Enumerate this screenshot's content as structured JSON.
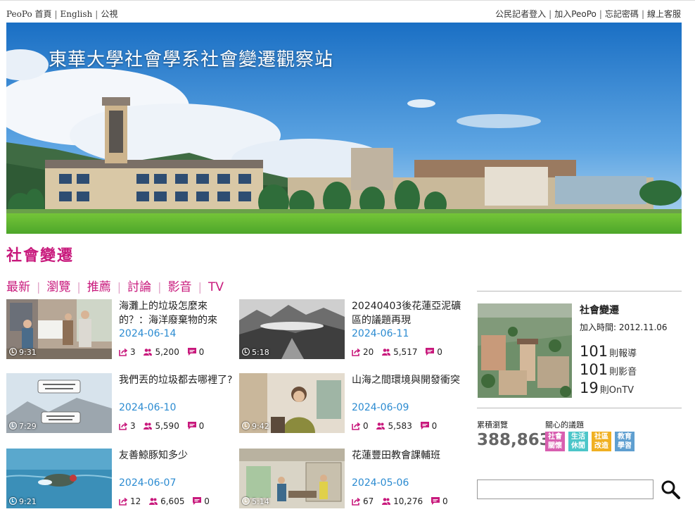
{
  "topbar": {
    "left": [
      "PeoPo 首頁",
      "English",
      "公視"
    ],
    "right": [
      "公民記者登入",
      "加入PeoPo",
      "忘記密碼",
      "線上客服"
    ]
  },
  "banner": {
    "title": "東華大學社會學系社會變遷觀察站"
  },
  "section": {
    "title": "社會變遷"
  },
  "tabs": [
    "最新",
    "瀏覽",
    "推薦",
    "討論",
    "影音",
    "TV"
  ],
  "articles": [
    {
      "title": "海灘上的垃圾怎麼來的？：海洋廢棄物的來",
      "date": "2024-06-14",
      "duration": "9:31",
      "shares": "3",
      "views": "5,200",
      "comments": "0"
    },
    {
      "title": "20240403後花蓮亞泥礦區的議題再現",
      "date": "2024-06-11",
      "duration": "5:18",
      "shares": "20",
      "views": "5,517",
      "comments": "0"
    },
    {
      "title": "我們丟的垃圾都去哪裡了?",
      "date": "2024-06-10",
      "duration": "7:29",
      "shares": "3",
      "views": "5,590",
      "comments": "0"
    },
    {
      "title": "山海之間環境與開發衝突",
      "date": "2024-06-09",
      "duration": "9:42",
      "shares": "0",
      "views": "5,583",
      "comments": "0"
    },
    {
      "title": "友善鯨豚知多少",
      "date": "2024-06-07",
      "duration": "9:21",
      "shares": "12",
      "views": "6,605",
      "comments": "0"
    },
    {
      "title": "花蓮豐田教會課輔班",
      "date": "2024-05-06",
      "duration": "5:14",
      "shares": "67",
      "views": "10,276",
      "comments": "0"
    }
  ],
  "sidebar": {
    "name": "社會變遷",
    "joined": "加入時間: 2012.11.06",
    "reports_num": "101",
    "reports_label": "則報導",
    "videos_num": "101",
    "videos_label": "則影音",
    "ontv_num": "19",
    "ontv_label": "則OnTV",
    "views_label": "累積瀏覽",
    "views": "388,863",
    "tags_label": "關心的議題",
    "tags": [
      {
        "line1": "社會",
        "line2": "關懷",
        "color": "#d85fb0"
      },
      {
        "line1": "生活",
        "line2": "休閒",
        "color": "#4cc6c9"
      },
      {
        "line1": "社區",
        "line2": "改造",
        "color": "#f0b022"
      },
      {
        "line1": "教育",
        "line2": "學習",
        "color": "#5f9fd0"
      }
    ]
  },
  "search": {
    "placeholder": ""
  },
  "icons": {
    "share": "share-icon",
    "people": "people-icon",
    "comment": "comment-icon",
    "clock": "clock-icon",
    "search": "magnifier-icon"
  },
  "colors": {
    "accent": "#c8197c",
    "date": "#2b8bd1",
    "stat_icon": "#c8197c"
  }
}
